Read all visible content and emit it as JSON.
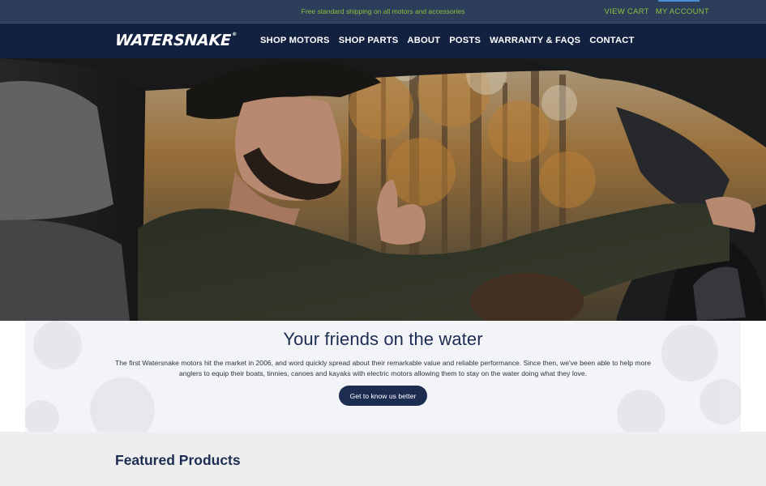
{
  "topbar": {
    "promo": "Free standard shipping on all motors and accessories",
    "view_cart": "VIEW CART",
    "my_account": "MY ACCOUNT"
  },
  "header": {
    "logo_text": "WATERSNAKE",
    "logo_mark": "®",
    "nav": [
      {
        "label": "SHOP MOTORS"
      },
      {
        "label": "SHOP PARTS"
      },
      {
        "label": "ABOUT"
      },
      {
        "label": "POSTS"
      },
      {
        "label": "WARRANTY & FAQS"
      },
      {
        "label": "CONTACT"
      }
    ]
  },
  "hero": {
    "image_subject": "man driving a vehicle past autumn trees"
  },
  "intro": {
    "heading": "Your friends on the water",
    "body": "The first Watersnake motors hit the market in 2006, and word quickly spread about their remarkable value and reliable performance. Since then, we've been able to help more anglers to equip their boats, tinnies, canoes and kayaks with electric motors allowing them to stay on the water doing what they love.",
    "cta_label": "Get to know us better"
  },
  "featured": {
    "heading": "Featured Products"
  },
  "colors": {
    "navy": "#12213f",
    "topbar": "#2c3e5a",
    "accent_green": "#8fbf3f",
    "heading_blue": "#1d2d52",
    "button": "#1d2d52"
  }
}
